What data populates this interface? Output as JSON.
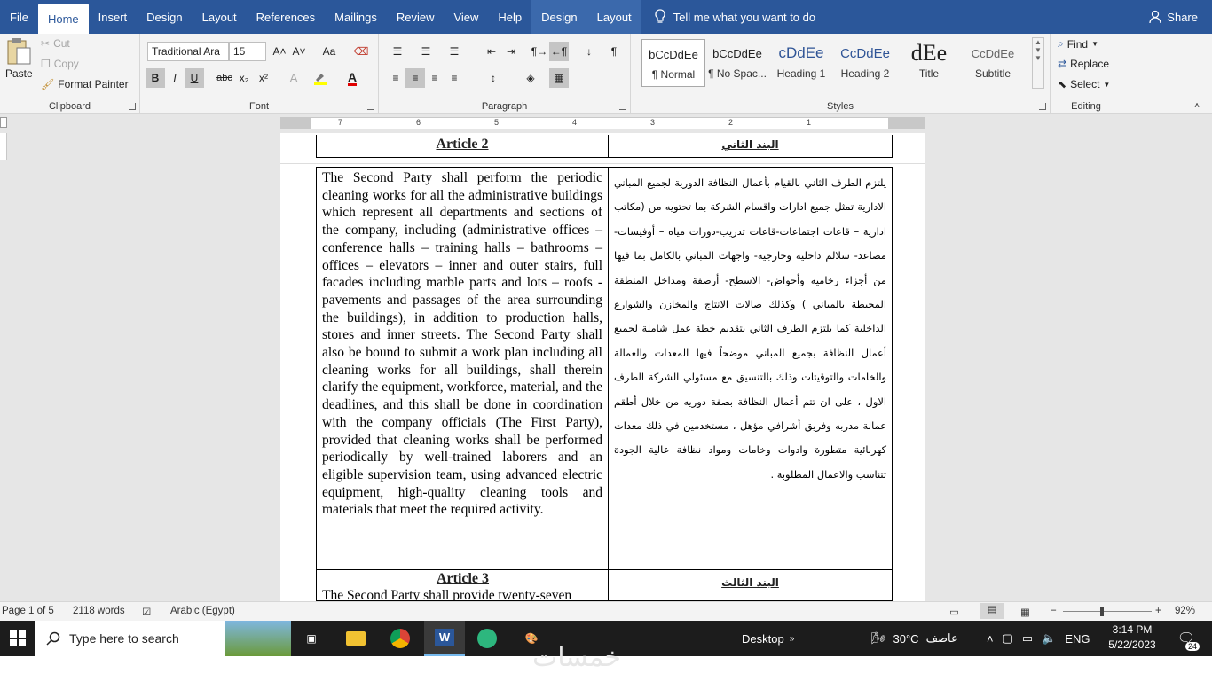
{
  "menu": {
    "tabs": [
      "File",
      "Home",
      "Insert",
      "Design",
      "Layout",
      "References",
      "Mailings",
      "Review",
      "View",
      "Help",
      "Design",
      "Layout"
    ],
    "tell_me": "Tell me what you want to do",
    "share": "Share"
  },
  "ribbon": {
    "clipboard": {
      "label": "Clipboard",
      "paste": "Paste",
      "cut": "Cut",
      "copy": "Copy",
      "format_painter": "Format Painter"
    },
    "font": {
      "label": "Font",
      "font_name": "Traditional Ara",
      "font_size": "15",
      "change_case": "Aa",
      "bold": "B",
      "italic": "I",
      "underline": "U",
      "strike": "abc",
      "sub": "x₂",
      "sup": "x²"
    },
    "paragraph": {
      "label": "Paragraph"
    },
    "styles": {
      "label": "Styles",
      "items": [
        {
          "preview": "bCcDdEe",
          "name": "¶ Normal"
        },
        {
          "preview": "bCcDdEe",
          "name": "¶ No Spac..."
        },
        {
          "preview": "cDdEe",
          "name": "Heading 1"
        },
        {
          "preview": "CcDdEe",
          "name": "Heading 2"
        },
        {
          "preview": "dEe",
          "name": "Title"
        },
        {
          "preview": "CcDdEe",
          "name": "Subtitle"
        }
      ]
    },
    "editing": {
      "label": "Editing",
      "find": "Find",
      "replace": "Replace",
      "select": "Select"
    }
  },
  "ruler": {
    "numbers": [
      "7",
      "6",
      "5",
      "4",
      "3",
      "2",
      "1"
    ]
  },
  "document": {
    "article2_en": "Article 2",
    "article2_ar": "البند الثاني",
    "body_en": "The Second Party shall perform the periodic cleaning works for all the administrative buildings which represent all departments and sections of the company, including (administrative offices – conference halls – training halls – bathrooms – offices – elevators – inner and outer stairs, full facades including marble parts and lots – roofs - pavements and passages of the area surrounding the buildings), in addition to production halls, stores and inner streets. The Second Party shall also be bound to submit a work plan including all cleaning works for all buildings, shall therein clarify the equipment, workforce, material, and the deadlines, and this shall be done in coordination with the company officials (The First Party), provided that cleaning works shall be performed periodically by well-trained laborers and an eligible supervision team, using advanced electric equipment, high-quality cleaning tools and materials that meet the required activity.",
    "body_ar": "يلتزم الطرف الثاني بالقيام بأعمال النظافة الدورية لجميع المباني الادارية تمثل جميع ادارات واقسام الشركة بما تحتويه من (مكاتب ادارية – قاعات اجتماعات-قاعات تدريب-دورات مياه – أوفيسات- مصاعد- سلالم داخلية وخارجية- واجهات المباني بالكامل بما فيها من أجزاء رخاميه وأحواض- الاسطح- أرصفة ومداخل المنطقة المحيطة بالمباني ) وكذلك صالات الانتاج والمخازن والشوارع الداخلية كما يلتزم الطرف الثاني بتقديم خطة عمل شاملة لجميع أعمال النظافة بجميع المباني موضحاً فيها المعدات والعمالة والخامات والتوقيتات وذلك بالتنسيق مع مسئولي الشركة الطرف الاول ، على ان تتم أعمال النظافة بصفة دوريه من خلال أطقم عمالة مدربه وفريق أشرافي مؤهل ، مستخدمين في ذلك معدات كهربائية متطورة وادوات وخامات ومواد نظافة عالية الجودة تتناسب والاعمال المطلوبة .",
    "article3_en": "Article 3",
    "article3_ar": "البند الثالث",
    "body3_en": "The Second Party shall provide twenty-seven"
  },
  "status": {
    "page": "Page 1 of 5",
    "words": "2118 words",
    "language": "Arabic (Egypt)",
    "zoom": "92%"
  },
  "taskbar": {
    "search_placeholder": "Type here to search",
    "desktop": "Desktop",
    "weather_temp": "30°C",
    "weather_desc": "عاصف",
    "lang": "ENG",
    "time": "3:14 PM",
    "date": "5/22/2023",
    "notif_count": "24"
  },
  "watermark": "خمسات",
  "colors": {
    "word_blue": "#2b579a",
    "taskbar": "#1c1c1c"
  }
}
